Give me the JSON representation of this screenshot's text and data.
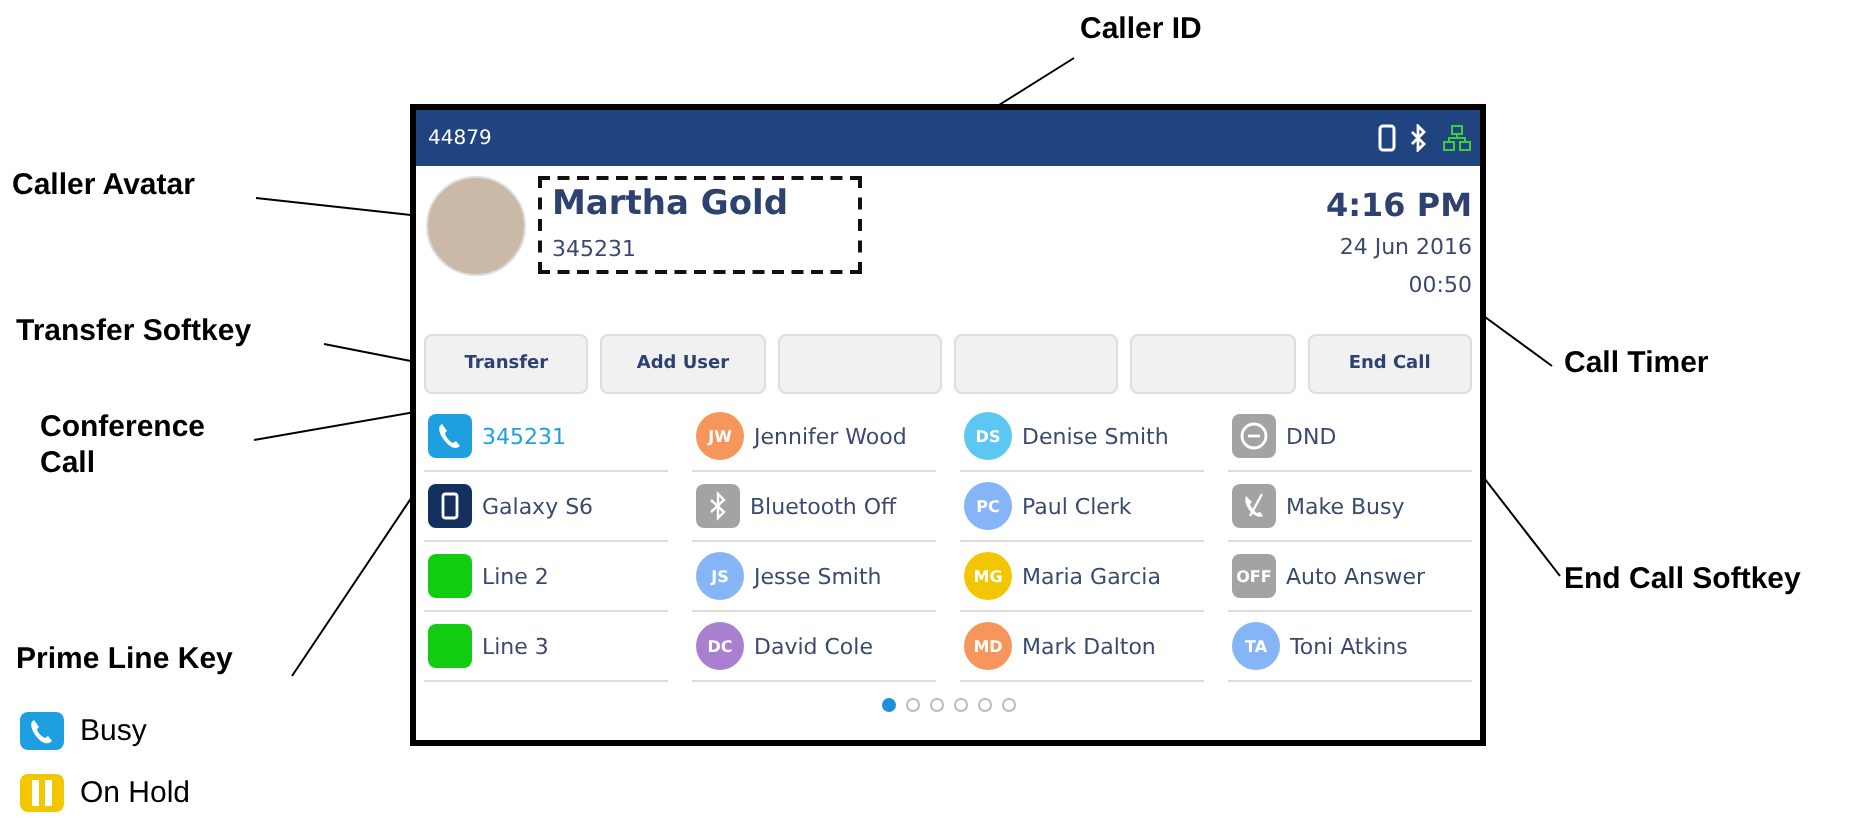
{
  "annotations": [
    {
      "label": "Caller ID"
    },
    {
      "label": "Caller Avatar"
    },
    {
      "label": "Transfer Softkey"
    },
    {
      "label": "Conference Call"
    },
    {
      "label": "Call Timer"
    },
    {
      "label": "End Call Softkey"
    },
    {
      "label": "Prime Line Key"
    }
  ],
  "phone": {
    "status_bar": {
      "extension": "44879"
    },
    "call": {
      "name": "Martha Gold",
      "number": "345231",
      "time": "4:16 PM",
      "date": "24 Jun 2016",
      "timer": "00:50"
    },
    "softkeys": [
      {
        "kind": "key",
        "label": "Transfer"
      },
      {
        "kind": "key",
        "label": "Add User"
      },
      {
        "kind": "blank"
      },
      {
        "kind": "blank"
      },
      {
        "kind": "blank"
      },
      {
        "kind": "key",
        "label": "End Call"
      }
    ],
    "line_keys": [
      {
        "kind": "line",
        "label": "345231",
        "busy": true,
        "color": "#1ea0e0"
      },
      {
        "kind": "contact",
        "label": "Jennifer Wood",
        "initials": "JW",
        "busy": false,
        "color": "#f7965a"
      },
      {
        "kind": "contact",
        "label": "Denise Smith",
        "initials": "DS",
        "busy": false,
        "color": "#5cc8f2"
      },
      {
        "kind": "dnd",
        "label": "DND",
        "busy": false
      },
      {
        "kind": "device",
        "label": "Galaxy S6",
        "busy": false
      },
      {
        "kind": "bluetooth",
        "label": "Bluetooth Off",
        "busy": false
      },
      {
        "kind": "contact",
        "label": "Paul Clerk",
        "initials": "PC",
        "busy": false,
        "color": "#86b5f7"
      },
      {
        "kind": "makebusy",
        "label": "Make Busy",
        "busy": false
      },
      {
        "kind": "line",
        "label": "Line 2",
        "busy": false,
        "color": "#12cc12"
      },
      {
        "kind": "contact",
        "label": "Jesse Smith",
        "initials": "JS",
        "busy": false,
        "color": "#86b5f7"
      },
      {
        "kind": "contact",
        "label": "Maria Garcia",
        "initials": "MG",
        "busy": false,
        "color": "#f2c600"
      },
      {
        "kind": "badge",
        "label": "Auto Answer",
        "badge": "OFF",
        "busy": false
      },
      {
        "kind": "line",
        "label": "Line 3",
        "busy": false,
        "color": "#12cc12"
      },
      {
        "kind": "contact",
        "label": "David Cole",
        "initials": "DC",
        "busy": false,
        "color": "#a97fd0"
      },
      {
        "kind": "contact",
        "label": "Mark Dalton",
        "initials": "MD",
        "busy": false,
        "color": "#f7965a"
      },
      {
        "kind": "contact",
        "label": "Toni Atkins",
        "initials": "TA",
        "busy": false,
        "color": "#86b5f7"
      }
    ],
    "pages": [
      {
        "selected": true
      },
      {
        "selected": false
      },
      {
        "selected": false
      },
      {
        "selected": false
      },
      {
        "selected": false
      },
      {
        "selected": false
      }
    ]
  },
  "legend": [
    {
      "kind": "busy",
      "label": "Busy"
    },
    {
      "kind": "hold",
      "label": "On Hold"
    }
  ]
}
